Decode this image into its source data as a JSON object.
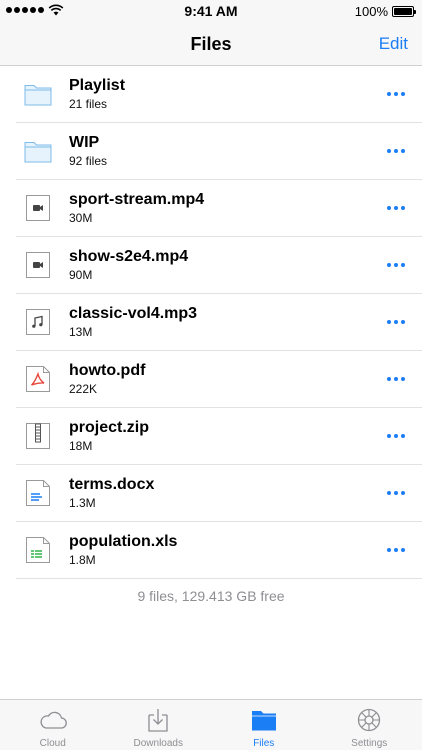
{
  "status_bar": {
    "time": "9:41 AM",
    "battery": "100%"
  },
  "nav": {
    "title": "Files",
    "edit_label": "Edit"
  },
  "files": [
    {
      "name": "Playlist",
      "meta": "21 files",
      "icon": "folder-icon"
    },
    {
      "name": "WIP",
      "meta": "92 files",
      "icon": "folder-icon"
    },
    {
      "name": "sport-stream.mp4",
      "meta": "30M",
      "icon": "video-file-icon"
    },
    {
      "name": "show-s2e4.mp4",
      "meta": "90M",
      "icon": "video-file-icon"
    },
    {
      "name": "classic-vol4.mp3",
      "meta": "13M",
      "icon": "audio-file-icon"
    },
    {
      "name": "howto.pdf",
      "meta": "222K",
      "icon": "pdf-file-icon"
    },
    {
      "name": "project.zip",
      "meta": "18M",
      "icon": "zip-file-icon"
    },
    {
      "name": "terms.docx",
      "meta": "1.3M",
      "icon": "doc-file-icon"
    },
    {
      "name": "population.xls",
      "meta": "1.8M",
      "icon": "spreadsheet-file-icon"
    }
  ],
  "summary": "9 files, 129.413 GB free",
  "tabs": [
    {
      "label": "Cloud",
      "icon": "cloud-icon",
      "active": false
    },
    {
      "label": "Downloads",
      "icon": "download-icon",
      "active": false
    },
    {
      "label": "Files",
      "icon": "folder-icon",
      "active": true
    },
    {
      "label": "Settings",
      "icon": "gear-icon",
      "active": false
    }
  ],
  "colors": {
    "accent": "#1c7ef5",
    "folder": "#8cc6f0",
    "pdf": "#e8463a",
    "doc": "#1c7ef5",
    "xls": "#2eb34a"
  }
}
